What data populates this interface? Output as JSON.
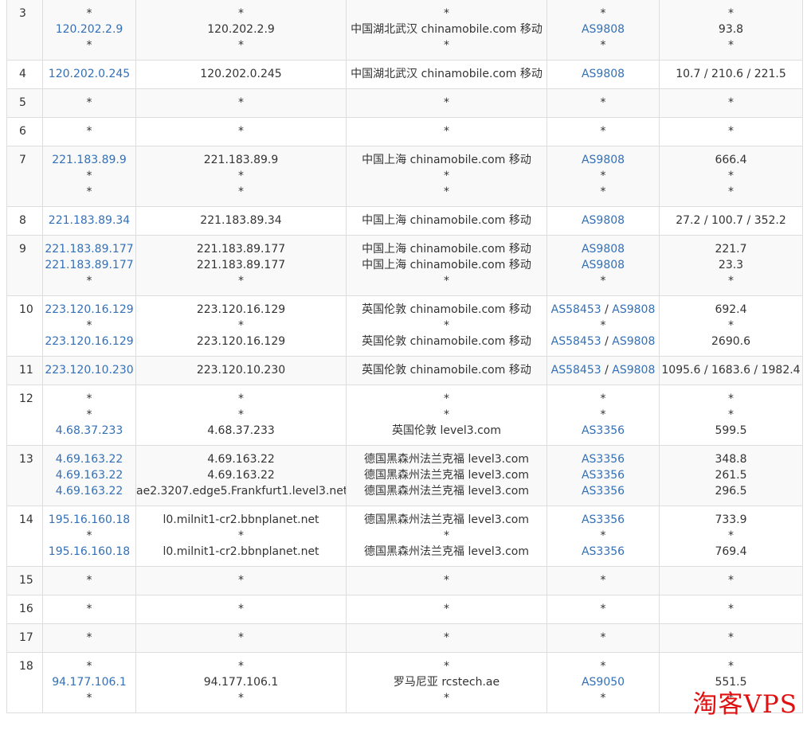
{
  "rows": [
    {
      "hop": "3",
      "ip": [
        "*",
        "120.202.2.9",
        "*"
      ],
      "host": [
        "*",
        "120.202.2.9",
        "*"
      ],
      "loc": [
        "*",
        "中国湖北武汉 chinamobile.com 移动",
        "*"
      ],
      "as": [
        [
          "*"
        ],
        [
          "AS9808"
        ],
        [
          "*"
        ]
      ],
      "time": [
        "*",
        "93.8",
        "*"
      ]
    },
    {
      "hop": "4",
      "ip": [
        "120.202.0.245"
      ],
      "host": [
        "120.202.0.245"
      ],
      "loc": [
        "中国湖北武汉 chinamobile.com 移动"
      ],
      "as": [
        [
          "AS9808"
        ]
      ],
      "time": [
        "10.7 / 210.6 / 221.5"
      ]
    },
    {
      "hop": "5",
      "ip": [
        "*"
      ],
      "host": [
        "*"
      ],
      "loc": [
        "*"
      ],
      "as": [
        [
          "*"
        ]
      ],
      "time": [
        "*"
      ]
    },
    {
      "hop": "6",
      "ip": [
        "*"
      ],
      "host": [
        "*"
      ],
      "loc": [
        "*"
      ],
      "as": [
        [
          "*"
        ]
      ],
      "time": [
        "*"
      ]
    },
    {
      "hop": "7",
      "ip": [
        "221.183.89.9",
        "*",
        "*"
      ],
      "host": [
        "221.183.89.9",
        "*",
        "*"
      ],
      "loc": [
        "中国上海 chinamobile.com 移动",
        "*",
        "*"
      ],
      "as": [
        [
          "AS9808"
        ],
        [
          "*"
        ],
        [
          "*"
        ]
      ],
      "time": [
        "666.4",
        "*",
        "*"
      ]
    },
    {
      "hop": "8",
      "ip": [
        "221.183.89.34"
      ],
      "host": [
        "221.183.89.34"
      ],
      "loc": [
        "中国上海 chinamobile.com 移动"
      ],
      "as": [
        [
          "AS9808"
        ]
      ],
      "time": [
        "27.2 / 100.7 / 352.2"
      ]
    },
    {
      "hop": "9",
      "ip": [
        "221.183.89.177",
        "221.183.89.177",
        "*"
      ],
      "host": [
        "221.183.89.177",
        "221.183.89.177",
        "*"
      ],
      "loc": [
        "中国上海 chinamobile.com 移动",
        "中国上海 chinamobile.com 移动",
        "*"
      ],
      "as": [
        [
          "AS9808"
        ],
        [
          "AS9808"
        ],
        [
          "*"
        ]
      ],
      "time": [
        "221.7",
        "23.3",
        "*"
      ]
    },
    {
      "hop": "10",
      "ip": [
        "223.120.16.129",
        "*",
        "223.120.16.129"
      ],
      "host": [
        "223.120.16.129",
        "*",
        "223.120.16.129"
      ],
      "loc": [
        "英国伦敦 chinamobile.com 移动",
        "*",
        "英国伦敦 chinamobile.com 移动"
      ],
      "as": [
        [
          "AS58453",
          "AS9808"
        ],
        [
          "*"
        ],
        [
          "AS58453",
          "AS9808"
        ]
      ],
      "time": [
        "692.4",
        "*",
        "2690.6"
      ]
    },
    {
      "hop": "11",
      "ip": [
        "223.120.10.230"
      ],
      "host": [
        "223.120.10.230"
      ],
      "loc": [
        "英国伦敦 chinamobile.com 移动"
      ],
      "as": [
        [
          "AS58453",
          "AS9808"
        ]
      ],
      "time": [
        "1095.6 / 1683.6 / 1982.4"
      ]
    },
    {
      "hop": "12",
      "ip": [
        "*",
        "*",
        "4.68.37.233"
      ],
      "host": [
        "*",
        "*",
        "4.68.37.233"
      ],
      "loc": [
        "*",
        "*",
        "英国伦敦 level3.com"
      ],
      "as": [
        [
          "*"
        ],
        [
          "*"
        ],
        [
          "AS3356"
        ]
      ],
      "time": [
        "*",
        "*",
        "599.5"
      ]
    },
    {
      "hop": "13",
      "ip": [
        "4.69.163.22",
        "4.69.163.22",
        "4.69.163.22"
      ],
      "host": [
        "4.69.163.22",
        "4.69.163.22",
        "ae2.3207.edge5.Frankfurt1.level3.net"
      ],
      "loc": [
        "德国黑森州法兰克福 level3.com",
        "德国黑森州法兰克福 level3.com",
        "德国黑森州法兰克福 level3.com"
      ],
      "as": [
        [
          "AS3356"
        ],
        [
          "AS3356"
        ],
        [
          "AS3356"
        ]
      ],
      "time": [
        "348.8",
        "261.5",
        "296.5"
      ]
    },
    {
      "hop": "14",
      "ip": [
        "195.16.160.18",
        "*",
        "195.16.160.18"
      ],
      "host": [
        "l0.milnit1-cr2.bbnplanet.net",
        "*",
        "l0.milnit1-cr2.bbnplanet.net"
      ],
      "loc": [
        "德国黑森州法兰克福 level3.com",
        "*",
        "德国黑森州法兰克福 level3.com"
      ],
      "as": [
        [
          "AS3356"
        ],
        [
          "*"
        ],
        [
          "AS3356"
        ]
      ],
      "time": [
        "733.9",
        "*",
        "769.4"
      ]
    },
    {
      "hop": "15",
      "ip": [
        "*"
      ],
      "host": [
        "*"
      ],
      "loc": [
        "*"
      ],
      "as": [
        [
          "*"
        ]
      ],
      "time": [
        "*"
      ]
    },
    {
      "hop": "16",
      "ip": [
        "*"
      ],
      "host": [
        "*"
      ],
      "loc": [
        "*"
      ],
      "as": [
        [
          "*"
        ]
      ],
      "time": [
        "*"
      ]
    },
    {
      "hop": "17",
      "ip": [
        "*"
      ],
      "host": [
        "*"
      ],
      "loc": [
        "*"
      ],
      "as": [
        [
          "*"
        ]
      ],
      "time": [
        "*"
      ]
    },
    {
      "hop": "18",
      "ip": [
        "*",
        "94.177.106.1",
        "*"
      ],
      "host": [
        "*",
        "94.177.106.1",
        "*"
      ],
      "loc": [
        "*",
        "罗马尼亚 rcstech.ae",
        "*"
      ],
      "as": [
        [
          "*"
        ],
        [
          "AS9050"
        ],
        [
          "*"
        ]
      ],
      "time": [
        "*",
        "551.5",
        "*"
      ]
    }
  ],
  "watermark": "淘客VPS",
  "colors": {
    "link": "#3370b7",
    "text": "#333333",
    "stripe": "#f9f9f9",
    "border": "#dddddd",
    "watermark": "#e01010"
  }
}
